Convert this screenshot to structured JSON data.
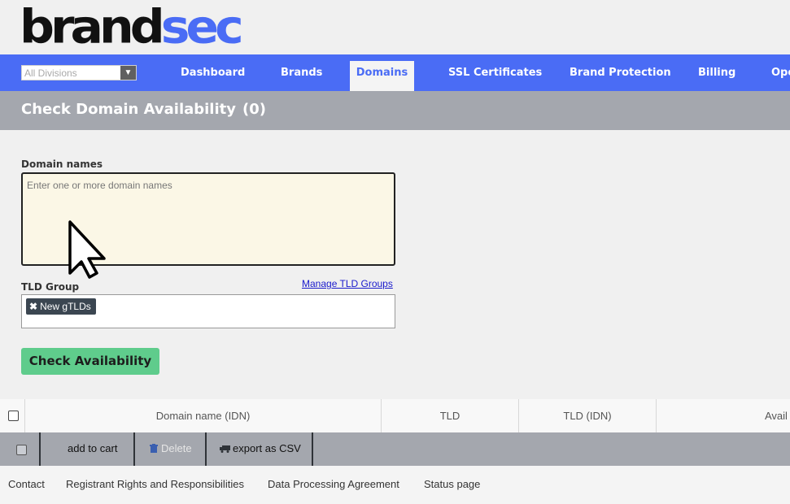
{
  "logo": {
    "part1": "brand",
    "part2": "sec"
  },
  "division_select": {
    "value": "All Divisions"
  },
  "nav": {
    "items": [
      {
        "label": "Dashboard"
      },
      {
        "label": "Brands"
      },
      {
        "label": "Domains"
      },
      {
        "label": "SSL Certificates"
      },
      {
        "label": "Brand Protection"
      },
      {
        "label": "Billing"
      },
      {
        "label": "Ope"
      }
    ],
    "active": "Domains"
  },
  "page": {
    "title": "Check Domain Availability",
    "count": "(0)"
  },
  "form": {
    "domain_label": "Domain names",
    "domain_placeholder": "Enter one or more domain names",
    "tld_label": "TLD Group",
    "manage_link": "Manage TLD Groups",
    "tld_tag": "New gTLDs",
    "check_button": "Check Availability"
  },
  "table": {
    "columns": [
      "Domain name (IDN)",
      "TLD",
      "TLD (IDN)",
      "Avail"
    ]
  },
  "actions": {
    "add_to_cart": "add to cart",
    "delete": "Delete",
    "export": "export as CSV"
  },
  "footer": {
    "links": [
      "Contact",
      "Registrant Rights and Responsibilities",
      "Data Processing Agreement",
      "Status page"
    ]
  },
  "colors": {
    "brand_blue": "#4a6cf5",
    "button_green": "#5fcc8c",
    "bar_gray": "#a4a7ae"
  },
  "icons": [
    "dropdown-arrow-icon",
    "remove-tag-icon",
    "trash-icon",
    "truck-icon",
    "mouse-cursor-icon"
  ]
}
